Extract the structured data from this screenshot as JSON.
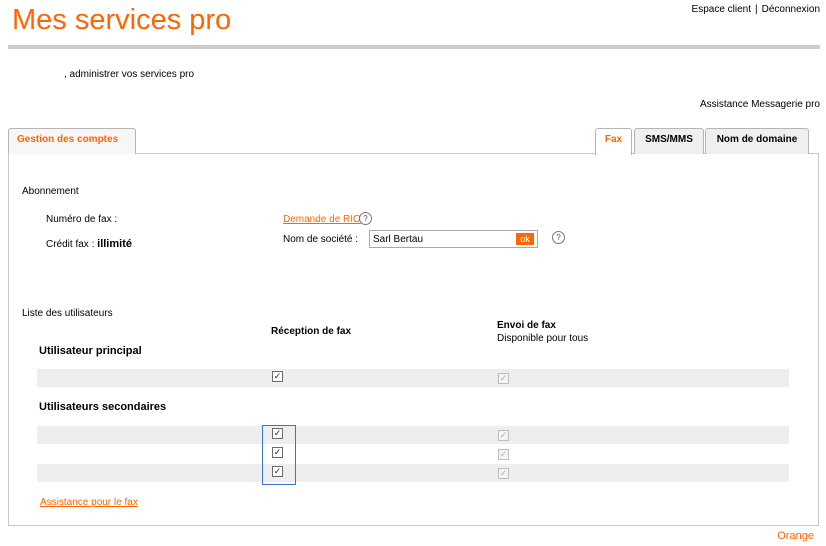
{
  "header": {
    "title": "Mes services pro",
    "links": {
      "espace_client": "Espace client",
      "separator": "|",
      "deconnexion": "Déconnexion"
    }
  },
  "greeting": ", administrer vos services pro",
  "assistance_messagerie": "Assistance Messagerie pro",
  "tabs": {
    "gestion": "Gestion des comptes",
    "fax": "Fax",
    "sms": "SMS/MMS",
    "domaine": "Nom de domaine"
  },
  "abonnement": {
    "section_title": "Abonnement",
    "numero_label": "Numéro de fax :",
    "credit_label": "Crédit fax :",
    "credit_value": "illimité",
    "demande_rio": "Demande de RIO",
    "societe_label": "Nom de société :",
    "societe_value": "Sarl Bertau",
    "ok_label": "ok",
    "help_glyph": "?"
  },
  "users": {
    "section_title": "Liste des utilisateurs",
    "col_reception": "Réception de fax",
    "col_envoi": "Envoi de fax",
    "col_envoi_sub": "Disponible pour tous",
    "principal_label": "Utilisateur principal",
    "secondaires_label": "Utilisateurs secondaires",
    "principal_row": {
      "reception_checked": true,
      "envoi_checked": true
    },
    "secondary_rows": [
      {
        "reception_checked": true,
        "envoi_checked": true
      },
      {
        "reception_checked": true,
        "envoi_checked": true
      },
      {
        "reception_checked": true,
        "envoi_checked": true
      }
    ]
  },
  "assistance_fax": "Assistance pour le fax",
  "footer_brand": "Orange",
  "colors": {
    "accent": "#ff6600",
    "focus": "#3b73d1",
    "band": "#eeeeee"
  }
}
